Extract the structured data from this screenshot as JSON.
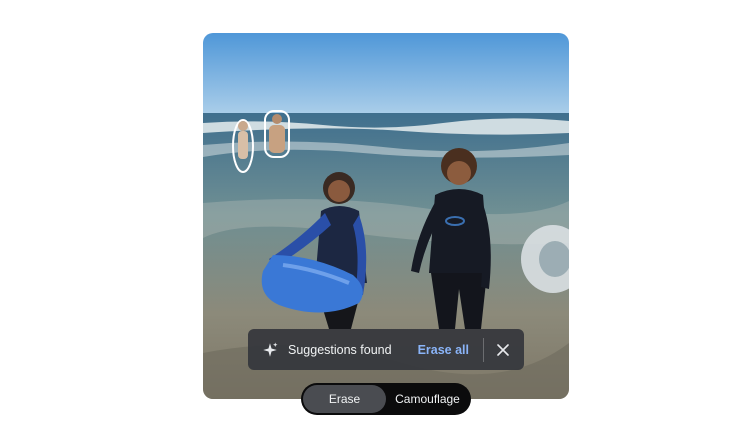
{
  "toast": {
    "icon": "sparkle-icon",
    "message": "Suggestions found",
    "erase_all_label": "Erase all",
    "close_icon": "close-icon"
  },
  "mode_switch": {
    "options": [
      {
        "label": "Erase",
        "selected": true
      },
      {
        "label": "Camouflage",
        "selected": false
      }
    ]
  },
  "colors": {
    "accent": "#8ab4f8",
    "toast_bg": "#34363c",
    "switch_bg": "#0b0b0c",
    "switch_active": "#4a4c51"
  }
}
